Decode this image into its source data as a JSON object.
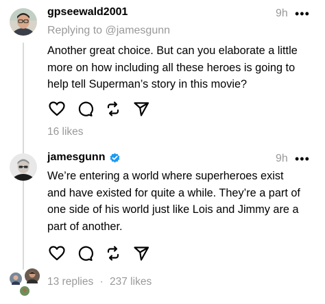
{
  "posts": [
    {
      "username": "gpseewald2001",
      "timestamp": "9h",
      "more_label": "•••",
      "replying_to": "Replying to @jamesgunn",
      "lines": [
        "Another great choice. But can you elaborate a little",
        "more on how including all these heroes is going to",
        "help tell Superman’s story in this movie?"
      ],
      "likes": "16 likes"
    },
    {
      "username": "jamesgunn",
      "verified": true,
      "timestamp": "9h",
      "more_label": "•••",
      "lines": [
        "We’re entering a world where superheroes exist",
        "and have existed for quite a while. They’re a part of",
        "one side of his world just like Lois and Jimmy are a",
        "part of another."
      ],
      "replies": "13 replies",
      "separator": "·",
      "likes": "237 likes"
    }
  ],
  "icons": {
    "like": "heart-icon",
    "reply": "comment-icon",
    "repost": "repost-icon",
    "share": "share-icon",
    "verified": "verified-badge-icon"
  },
  "colors": {
    "verified": "#1d9bf0",
    "muted": "#999999",
    "thread_line": "#d9d9d9"
  }
}
